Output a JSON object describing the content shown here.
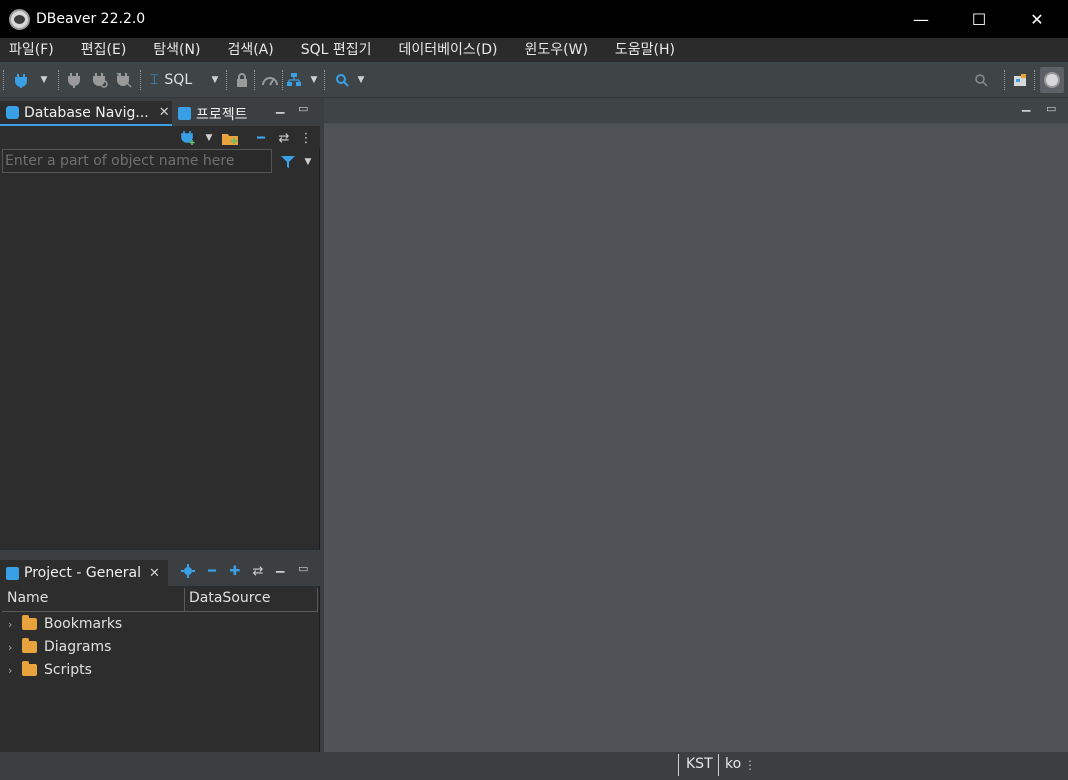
{
  "window": {
    "title": "DBeaver 22.2.0",
    "minimize": "—",
    "maximize": "☐",
    "close": "✕"
  },
  "menu": [
    "파일(F)",
    "편집(E)",
    "탐색(N)",
    "검색(A)",
    "SQL 편집기",
    "데이터베이스(D)",
    "윈도우(W)",
    "도움말(H)"
  ],
  "toolbar": {
    "sql_label": "SQL",
    "icons": [
      "new-connection-icon",
      "connect-icon",
      "invalidate-icon",
      "disconnect-icon",
      "sql-editor-icon",
      "transaction-lock-icon",
      "performance-icon",
      "schema-icon",
      "search-icon",
      "perspective-icon",
      "avatar-icon"
    ]
  },
  "navigator": {
    "tab_label": "Database Navig...",
    "projects_tab_label": "프로젝트",
    "search_placeholder": "Enter a part of object name here",
    "icons": [
      "new-connection-icon",
      "new-folder-icon",
      "collapse-icon",
      "link-icon",
      "more-icon",
      "filter-icon"
    ]
  },
  "project": {
    "tab_label": "Project - General",
    "columns": [
      "Name",
      "DataSource"
    ],
    "items": [
      {
        "label": "Bookmarks",
        "icon": "bookmarks-folder-icon"
      },
      {
        "label": "Diagrams",
        "icon": "diagrams-folder-icon"
      },
      {
        "label": "Scripts",
        "icon": "scripts-folder-icon"
      }
    ]
  },
  "status": {
    "timezone": "KST",
    "locale": "ko"
  },
  "colors": {
    "accent": "#3aa0e6",
    "folder": "#e8a33c",
    "editor_background": "#4f5357",
    "panel_background": "#2d2d2d"
  }
}
